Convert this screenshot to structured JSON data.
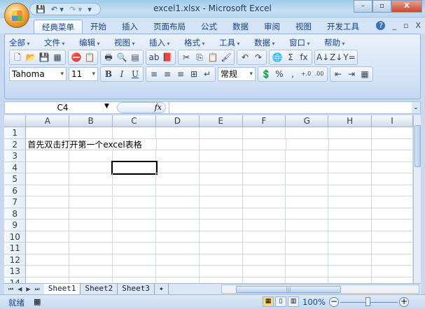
{
  "window": {
    "title": "excel1.xlsx - Microsoft Excel",
    "minimize": "–",
    "maximize": "▫",
    "close": "X"
  },
  "qat": {
    "save": "💾",
    "undo": "↶ ▾",
    "redo": "↷ ▾",
    "customize": "▾"
  },
  "ribbon_tabs": [
    "经典菜单",
    "开始",
    "插入",
    "页面布局",
    "公式",
    "数据",
    "审阅",
    "视图",
    "开发工具"
  ],
  "active_tab": "经典菜单",
  "tab_controls": {
    "help": "?",
    "minimize": "_",
    "restore": "▫",
    "close": "X"
  },
  "menus": [
    "全部",
    "文件",
    "编辑",
    "视图",
    "插入",
    "格式",
    "工具",
    "数据",
    "窗口",
    "帮助"
  ],
  "toolbar_icons": [
    [
      "new-icon",
      "open-icon",
      "save-icon",
      "excel-icon"
    ],
    [
      "permission-icon",
      "research-icon"
    ],
    [
      "print-icon",
      "print-preview-icon",
      "page-setup-icon"
    ],
    [
      "spelling-icon",
      "research2-icon"
    ],
    [
      "cut-icon",
      "copy-icon",
      "paste-icon",
      "format-painter-icon"
    ],
    [
      "undo-icon",
      "redo-icon"
    ],
    [
      "hyperlink-icon",
      "autosum-icon",
      "function-icon"
    ],
    [
      "sort-asc-icon",
      "sort-desc-icon",
      "filter-icon"
    ]
  ],
  "toolbar_glyphs": [
    [
      "🗋",
      "📂",
      "💾",
      "▦"
    ],
    [
      "⛔",
      "📋"
    ],
    [
      "🖶",
      "🔍",
      "▤"
    ],
    [
      "ab",
      "📕"
    ],
    [
      "✂",
      "⎘",
      "📋",
      "🖌"
    ],
    [
      "↶",
      "↷"
    ],
    [
      "🌐",
      "Σ",
      "fx"
    ],
    [
      "A↓",
      "Z↓",
      "Y="
    ]
  ],
  "format": {
    "font": "Tahoma",
    "size": "11",
    "bold": "B",
    "italic": "I",
    "underline": "U",
    "number_format": "常规",
    "percent": "%",
    "comma": ",",
    "inc_decimal": "+.0",
    "dec_decimal": ".00"
  },
  "formula_bar": {
    "name_box": "C4",
    "fx": "fx",
    "value": ""
  },
  "columns": [
    "A",
    "B",
    "C",
    "D",
    "E",
    "F",
    "G",
    "H",
    "I"
  ],
  "rows": [
    "1",
    "2",
    "3",
    "4",
    "5",
    "6",
    "7",
    "8",
    "9",
    "10",
    "11",
    "12",
    "13",
    "14"
  ],
  "cells": {
    "A2": "首先双击打开第一个excel表格"
  },
  "sheets": [
    "Sheet1",
    "Sheet2",
    "Sheet3"
  ],
  "active_sheet": "Sheet1",
  "status": {
    "ready": "就绪",
    "zoom": "100%"
  }
}
